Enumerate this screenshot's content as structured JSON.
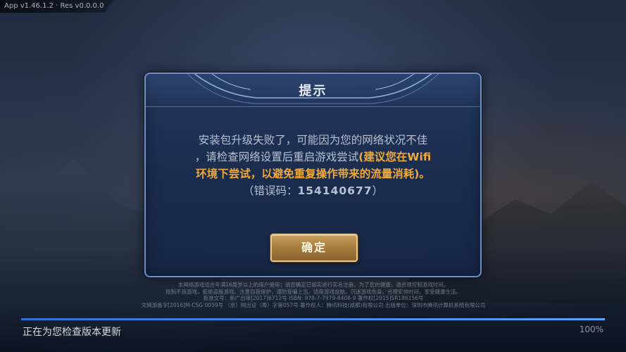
{
  "version_tag": "App v1.46.1.2 · Res v0.0.0.0",
  "dialog": {
    "title": "提示",
    "message_line1": "安装包升级失败了，可能因为您的网络状况不佳",
    "message_line2_prefix": "，请检查网络设置后重启游戏尝试",
    "message_highlight_a": "(建议您在Wifi",
    "message_highlight_b": "环境下尝试，以避免重复操作带来的流量消耗)。",
    "error_prefix": "（错误码：",
    "error_code": "154140677",
    "error_suffix": "）",
    "confirm_label": "确定"
  },
  "legal_lines": [
    "本网络游戏适合年满16周岁以上的用户使用；请您确定已如实进行实名注册。为了您的健康，请合理控制游戏时间。",
    "抵制不良游戏，拒绝盗版游戏。注意自我保护，谨防受骗上当。适度游戏益脑，沉迷游戏伤身。合理安排时间，享受健康生活。",
    "批准文号：新广出审[2017]6712号  ISBN: 978-7-7979-8408-9  著作权[2015]SR186156号",
    "文网游备字[2016]M-CSG 0059号  （京）网出证（粤）字第057号  著作权人：腾讯科技(成都)有限公司  出版单位：深圳市腾讯计算机系统有限公司"
  ],
  "status": {
    "text": "正在为您检查版本更新",
    "percent_label": "100%",
    "progress": 1.0
  },
  "colors": {
    "highlight": "#f0a93a",
    "dialog_border": "#6f90c4",
    "button_gold": "#c9a05e"
  }
}
